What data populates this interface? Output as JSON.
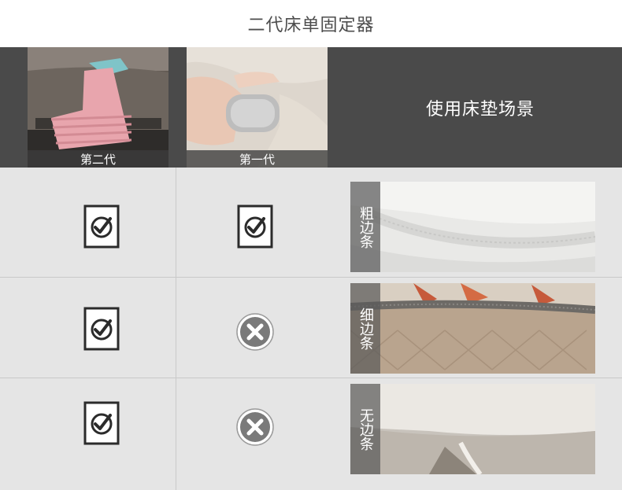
{
  "title": "二代床单固定器",
  "header": {
    "gen2_caption": "第二代",
    "gen1_caption": "第一代",
    "scene_label": "使用床垫场景"
  },
  "rows": [
    {
      "gen2": "check",
      "gen1": "check",
      "scene_label": "粗边条"
    },
    {
      "gen2": "check",
      "gen1": "cross",
      "scene_label": "细边条"
    },
    {
      "gen2": "check",
      "gen1": "cross",
      "scene_label": "无边条"
    }
  ],
  "colors": {
    "header_bg": "#4a4a4a",
    "grid_bg": "#e5e5e5",
    "check_stroke": "#2b2b2b",
    "cross_fill": "#7a7a7a"
  }
}
